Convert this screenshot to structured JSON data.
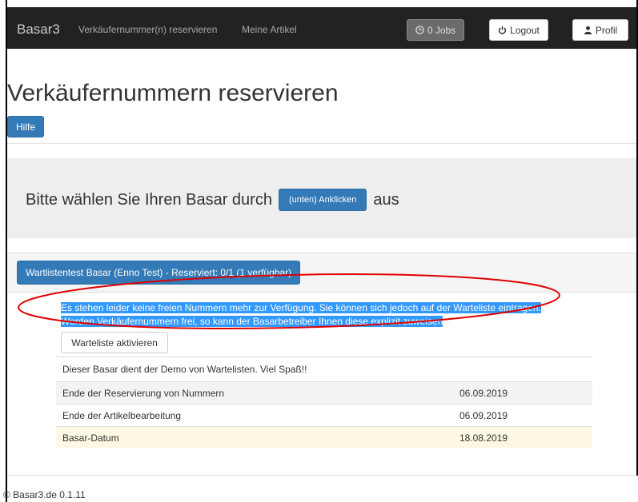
{
  "nav": {
    "brand": "Basar3",
    "links": [
      "Verkäufernummer(n) reservieren",
      "Meine Artikel"
    ],
    "jobs_label": "0 Jobs",
    "logout_label": "Logout",
    "profil_label": "Profil"
  },
  "page": {
    "title": "Verkäufernummern reservieren",
    "help_label": "Hilfe"
  },
  "jumbotron": {
    "text_before": "Bitte wählen Sie Ihren Basar durch",
    "button_label": "(unten) Anklicken",
    "text_after": "aus"
  },
  "basar": {
    "button_label": "Wartlistentest Basar (Enno Test) - Reserviert: 0/1 (1 verfügbar)",
    "info_text": "Es stehen leider keine freien Nummern mehr zur Verfügung. Sie können sich jedoch auf der Warteliste eintragen. Werden Verkäufernummern frei, so kann der Basarbetreiber Ihnen diese explizit zuweisen",
    "warteliste_label": "Warteliste aktivieren",
    "description": "Dieser Basar dient der Demo von Wartelisten. Viel Spaß!!",
    "rows": [
      {
        "label": "Ende der Reservierung von Nummern",
        "value": "06.09.2019"
      },
      {
        "label": "Ende der Artikelbearbeitung",
        "value": "06.09.2019"
      },
      {
        "label": "Basar-Datum",
        "value": "18.08.2019"
      }
    ]
  },
  "footer": "© Basar3.de 0.1.11",
  "colors": {
    "primary": "#337ab7",
    "navbar": "#222222",
    "annotation": "#e00000",
    "selection": "#3399ff"
  },
  "icons": [
    "clock-icon",
    "power-icon",
    "user-icon"
  ]
}
